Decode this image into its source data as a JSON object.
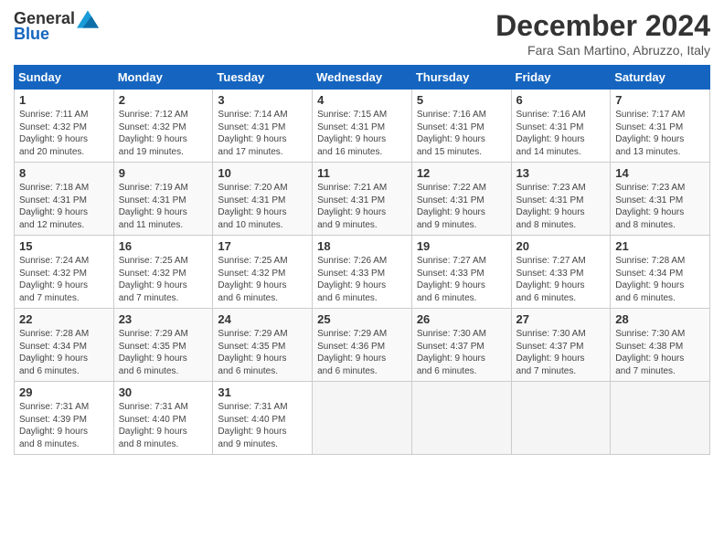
{
  "header": {
    "logo_general": "General",
    "logo_blue": "Blue",
    "month": "December 2024",
    "location": "Fara San Martino, Abruzzo, Italy"
  },
  "columns": [
    "Sunday",
    "Monday",
    "Tuesday",
    "Wednesday",
    "Thursday",
    "Friday",
    "Saturday"
  ],
  "weeks": [
    [
      {
        "day": "1",
        "info": "Sunrise: 7:11 AM\nSunset: 4:32 PM\nDaylight: 9 hours\nand 20 minutes."
      },
      {
        "day": "2",
        "info": "Sunrise: 7:12 AM\nSunset: 4:32 PM\nDaylight: 9 hours\nand 19 minutes."
      },
      {
        "day": "3",
        "info": "Sunrise: 7:14 AM\nSunset: 4:31 PM\nDaylight: 9 hours\nand 17 minutes."
      },
      {
        "day": "4",
        "info": "Sunrise: 7:15 AM\nSunset: 4:31 PM\nDaylight: 9 hours\nand 16 minutes."
      },
      {
        "day": "5",
        "info": "Sunrise: 7:16 AM\nSunset: 4:31 PM\nDaylight: 9 hours\nand 15 minutes."
      },
      {
        "day": "6",
        "info": "Sunrise: 7:16 AM\nSunset: 4:31 PM\nDaylight: 9 hours\nand 14 minutes."
      },
      {
        "day": "7",
        "info": "Sunrise: 7:17 AM\nSunset: 4:31 PM\nDaylight: 9 hours\nand 13 minutes."
      }
    ],
    [
      {
        "day": "8",
        "info": "Sunrise: 7:18 AM\nSunset: 4:31 PM\nDaylight: 9 hours\nand 12 minutes."
      },
      {
        "day": "9",
        "info": "Sunrise: 7:19 AM\nSunset: 4:31 PM\nDaylight: 9 hours\nand 11 minutes."
      },
      {
        "day": "10",
        "info": "Sunrise: 7:20 AM\nSunset: 4:31 PM\nDaylight: 9 hours\nand 10 minutes."
      },
      {
        "day": "11",
        "info": "Sunrise: 7:21 AM\nSunset: 4:31 PM\nDaylight: 9 hours\nand 9 minutes."
      },
      {
        "day": "12",
        "info": "Sunrise: 7:22 AM\nSunset: 4:31 PM\nDaylight: 9 hours\nand 9 minutes."
      },
      {
        "day": "13",
        "info": "Sunrise: 7:23 AM\nSunset: 4:31 PM\nDaylight: 9 hours\nand 8 minutes."
      },
      {
        "day": "14",
        "info": "Sunrise: 7:23 AM\nSunset: 4:31 PM\nDaylight: 9 hours\nand 8 minutes."
      }
    ],
    [
      {
        "day": "15",
        "info": "Sunrise: 7:24 AM\nSunset: 4:32 PM\nDaylight: 9 hours\nand 7 minutes."
      },
      {
        "day": "16",
        "info": "Sunrise: 7:25 AM\nSunset: 4:32 PM\nDaylight: 9 hours\nand 7 minutes."
      },
      {
        "day": "17",
        "info": "Sunrise: 7:25 AM\nSunset: 4:32 PM\nDaylight: 9 hours\nand 6 minutes."
      },
      {
        "day": "18",
        "info": "Sunrise: 7:26 AM\nSunset: 4:33 PM\nDaylight: 9 hours\nand 6 minutes."
      },
      {
        "day": "19",
        "info": "Sunrise: 7:27 AM\nSunset: 4:33 PM\nDaylight: 9 hours\nand 6 minutes."
      },
      {
        "day": "20",
        "info": "Sunrise: 7:27 AM\nSunset: 4:33 PM\nDaylight: 9 hours\nand 6 minutes."
      },
      {
        "day": "21",
        "info": "Sunrise: 7:28 AM\nSunset: 4:34 PM\nDaylight: 9 hours\nand 6 minutes."
      }
    ],
    [
      {
        "day": "22",
        "info": "Sunrise: 7:28 AM\nSunset: 4:34 PM\nDaylight: 9 hours\nand 6 minutes."
      },
      {
        "day": "23",
        "info": "Sunrise: 7:29 AM\nSunset: 4:35 PM\nDaylight: 9 hours\nand 6 minutes."
      },
      {
        "day": "24",
        "info": "Sunrise: 7:29 AM\nSunset: 4:35 PM\nDaylight: 9 hours\nand 6 minutes."
      },
      {
        "day": "25",
        "info": "Sunrise: 7:29 AM\nSunset: 4:36 PM\nDaylight: 9 hours\nand 6 minutes."
      },
      {
        "day": "26",
        "info": "Sunrise: 7:30 AM\nSunset: 4:37 PM\nDaylight: 9 hours\nand 6 minutes."
      },
      {
        "day": "27",
        "info": "Sunrise: 7:30 AM\nSunset: 4:37 PM\nDaylight: 9 hours\nand 7 minutes."
      },
      {
        "day": "28",
        "info": "Sunrise: 7:30 AM\nSunset: 4:38 PM\nDaylight: 9 hours\nand 7 minutes."
      }
    ],
    [
      {
        "day": "29",
        "info": "Sunrise: 7:31 AM\nSunset: 4:39 PM\nDaylight: 9 hours\nand 8 minutes."
      },
      {
        "day": "30",
        "info": "Sunrise: 7:31 AM\nSunset: 4:40 PM\nDaylight: 9 hours\nand 8 minutes."
      },
      {
        "day": "31",
        "info": "Sunrise: 7:31 AM\nSunset: 4:40 PM\nDaylight: 9 hours\nand 9 minutes."
      },
      null,
      null,
      null,
      null
    ]
  ]
}
